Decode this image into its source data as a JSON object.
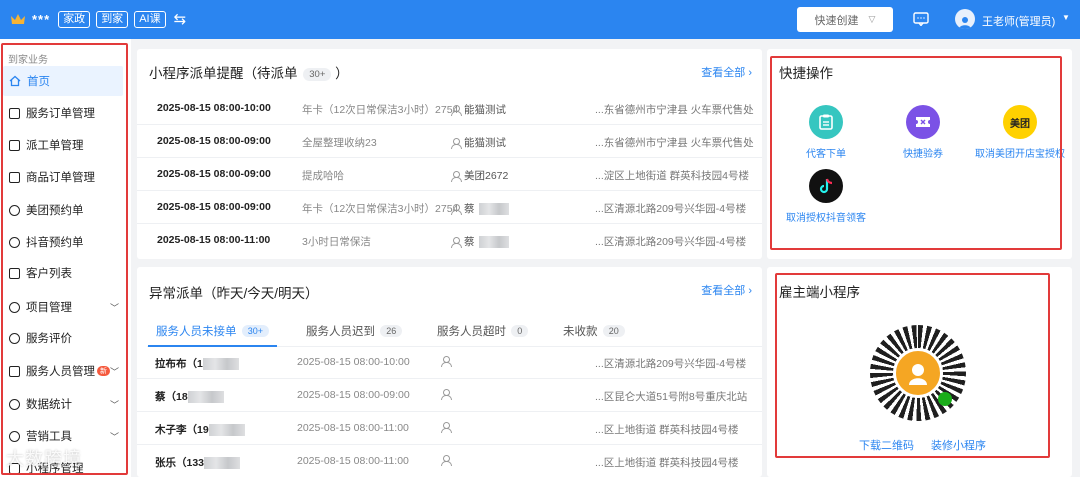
{
  "header": {
    "brand": "***",
    "tags": [
      "家政",
      "到家",
      "AI课"
    ],
    "quick_create": "快速创建",
    "user": "王老师(管理员)"
  },
  "sidebar": {
    "group": "到家业务",
    "items": [
      {
        "label": "首页",
        "icon": "home-icon",
        "active": true
      },
      {
        "label": "服务订单管理",
        "icon": "order-icon"
      },
      {
        "label": "派工单管理",
        "icon": "dispatch-icon"
      },
      {
        "label": "商品订单管理",
        "icon": "product-order-icon"
      },
      {
        "label": "美团预约单",
        "icon": "meituan-icon"
      },
      {
        "label": "抖音预约单",
        "icon": "douyin-icon"
      },
      {
        "label": "客户列表",
        "icon": "customer-icon"
      },
      {
        "label": "项目管理",
        "icon": "heart-icon",
        "expand": true
      },
      {
        "label": "服务评价",
        "icon": "review-icon"
      },
      {
        "label": "服务人员管理",
        "icon": "staff-icon",
        "expand": true,
        "badge": "新"
      },
      {
        "label": "数据统计",
        "icon": "stats-icon",
        "expand": true
      },
      {
        "label": "营销工具",
        "icon": "marketing-icon",
        "expand": true
      },
      {
        "label": "小程序管理",
        "icon": "miniapp-icon"
      }
    ]
  },
  "dispatch_reminder": {
    "title": "小程序派单提醒（待派单",
    "title_close": "）",
    "count": "30+",
    "view_all": "查看全部",
    "rows": [
      {
        "time": "2025-08-15 08:00-10:00",
        "service": "年卡（12次日常保洁3小时）2754",
        "user": "能猫测试",
        "address": "...东省德州市宁津县 火车票代售处"
      },
      {
        "time": "2025-08-15 08:00-09:00",
        "service": "全屋整理收纳23",
        "user": "能猫测试",
        "address": "...东省德州市宁津县 火车票代售处"
      },
      {
        "time": "2025-08-15 08:00-09:00",
        "service": "提成哈哈",
        "user": "美团2672",
        "address": "...淀区上地街道 群英科技园4号楼"
      },
      {
        "time": "2025-08-15 08:00-09:00",
        "service": "年卡（12次日常保洁3小时）2754",
        "user": "蔡",
        "address": "...区清源北路209号兴华园-4号楼"
      },
      {
        "time": "2025-08-15 08:00-11:00",
        "service": "3小时日常保洁",
        "user": "蔡",
        "address": "...区清源北路209号兴华园-4号楼"
      }
    ]
  },
  "abnormal": {
    "title": "异常派单（昨天/今天/明天）",
    "view_all": "查看全部",
    "tabs": [
      {
        "label": "服务人员未接单",
        "count": "30+"
      },
      {
        "label": "服务人员迟到",
        "count": "26"
      },
      {
        "label": "服务人员超时",
        "count": "0"
      },
      {
        "label": "未收款",
        "count": "20"
      }
    ],
    "rows": [
      {
        "name": "拉布布（1",
        "time": "2025-08-15 08:00-10:00",
        "address": "...区清源北路209号兴华园-4号楼"
      },
      {
        "name": "蔡（18",
        "time": "2025-08-15 08:00-09:00",
        "address": "...区昆仑大道51号附8号重庆北站"
      },
      {
        "name": "木子李（19",
        "time": "2025-08-15 08:00-11:00",
        "address": "...区上地街道 群英科技园4号楼"
      },
      {
        "name": "张乐（133",
        "time": "2025-08-15 08:00-11:00",
        "address": "...区上地街道 群英科技园4号楼"
      }
    ]
  },
  "quick_ops": {
    "title": "快捷操作",
    "items": [
      {
        "label": "代客下单",
        "icon": "clipboard-icon",
        "color": "#36c6c0"
      },
      {
        "label": "快捷验券",
        "icon": "ticket-icon",
        "color": "#7b52e6"
      },
      {
        "label": "取消美团开店宝授权",
        "icon": "meituan-logo-icon",
        "color": "#ffd100",
        "logo_text": "美团"
      },
      {
        "label": "取消授权抖音领客",
        "icon": "douyin-logo-icon",
        "color": "#111111"
      }
    ]
  },
  "miniapp": {
    "title": "雇主端小程序",
    "download": "下载二维码",
    "decorate": "装修小程序"
  },
  "watermark": "大数跨境",
  "colors": {
    "primary": "#2b85f0",
    "highlight": "#e23a3a"
  }
}
